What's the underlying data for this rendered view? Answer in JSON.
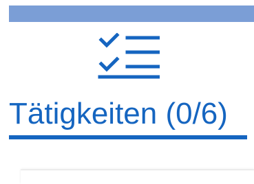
{
  "colors": {
    "header_bar": "#7b9ed6",
    "accent": "#1565c0",
    "card_border": "#e4e4e4"
  },
  "tab": {
    "icon": "checklist-icon",
    "label": "Tätigkeiten (0/6)",
    "selected": true
  }
}
